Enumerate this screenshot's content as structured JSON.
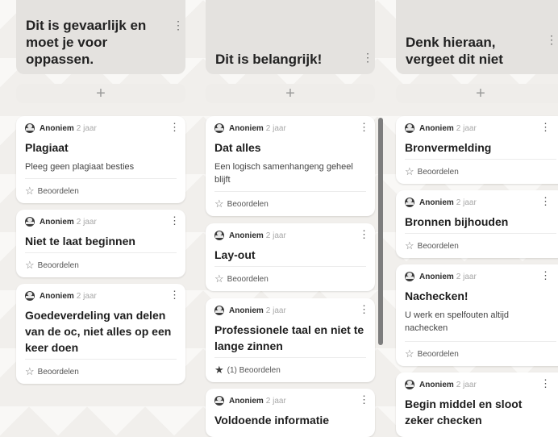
{
  "columns": [
    {
      "title": "Dit is gevaarlijk en moet je voor oppassen.",
      "menu": "⋮",
      "add": "+",
      "cards": [
        {
          "author": "Anoniem",
          "time": "2 jaar",
          "title": "Plagiaat",
          "body": "Pleeg geen plagiaat besties",
          "rating": "Beoordelen"
        },
        {
          "author": "Anoniem",
          "time": "2 jaar",
          "title": "Niet te laat beginnen",
          "body": "",
          "rating": "Beoordelen"
        },
        {
          "author": "Anoniem",
          "time": "2 jaar",
          "title": "Goedeverdeling van delen van de oc, niet alles op een keer doen",
          "body": "",
          "rating": "Beoordelen"
        }
      ]
    },
    {
      "title": "Dit is belangrijk!",
      "menu": "⋮",
      "add": "+",
      "cards": [
        {
          "author": "Anoniem",
          "time": "2 jaar",
          "title": "Dat alles",
          "body": "Een logisch samenhangeng geheel blijft",
          "rating": "Beoordelen"
        },
        {
          "author": "Anoniem",
          "time": "2 jaar",
          "title": "Lay-out",
          "body": "",
          "rating": "Beoordelen"
        },
        {
          "author": "Anoniem",
          "time": "2 jaar",
          "title": "Professionele taal en niet te lange zinnen",
          "body": "",
          "rating": "(1) Beoordelen",
          "rated": true
        },
        {
          "author": "Anoniem",
          "time": "2 jaar",
          "title": "Voldoende informatie",
          "body": "",
          "rating": ""
        }
      ]
    },
    {
      "title": "Denk hieraan, vergeet dit niet",
      "menu": "⋮",
      "add": "+",
      "cards": [
        {
          "author": "Anoniem",
          "time": "2 jaar",
          "title": "Bronvermelding",
          "body": "",
          "rating": "Beoordelen"
        },
        {
          "author": "Anoniem",
          "time": "2 jaar",
          "title": "Bronnen bijhouden",
          "body": "",
          "rating": "Beoordelen"
        },
        {
          "author": "Anoniem",
          "time": "2 jaar",
          "title": "Nachecken!",
          "body": "U werk en spelfouten altijd nachecken",
          "rating": "Beoordelen"
        },
        {
          "author": "Anoniem",
          "time": "2 jaar",
          "title": "Begin middel en sloot zeker checken",
          "body": "",
          "rating": ""
        }
      ]
    }
  ],
  "icons": {
    "star": "star-icon",
    "star_filled": "star-filled-icon",
    "avatar": "avatar-icon",
    "menu": "kebab-menu-icon"
  }
}
